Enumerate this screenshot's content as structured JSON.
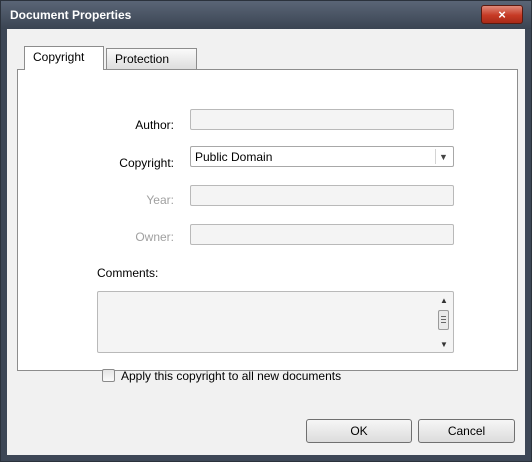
{
  "window": {
    "title": "Document Properties",
    "close_glyph": "×"
  },
  "tabs": [
    {
      "label": "Copyright",
      "active": true
    },
    {
      "label": "Protection",
      "active": false
    }
  ],
  "form": {
    "author_label": "Author:",
    "author_value": "",
    "copyright_label": "Copyright:",
    "copyright_value": "Public Domain",
    "year_label": "Year:",
    "year_value": "",
    "owner_label": "Owner:",
    "owner_value": "",
    "comments_label": "Comments:",
    "comments_value": "",
    "apply_checkbox_label": "Apply this copyright to all new documents",
    "apply_checked": false
  },
  "buttons": {
    "ok": "OK",
    "cancel": "Cancel"
  },
  "icons": {
    "select_arrow": "chevron-down-icon",
    "scroll_up": "arrow-up-icon",
    "scroll_down": "arrow-down-icon"
  }
}
